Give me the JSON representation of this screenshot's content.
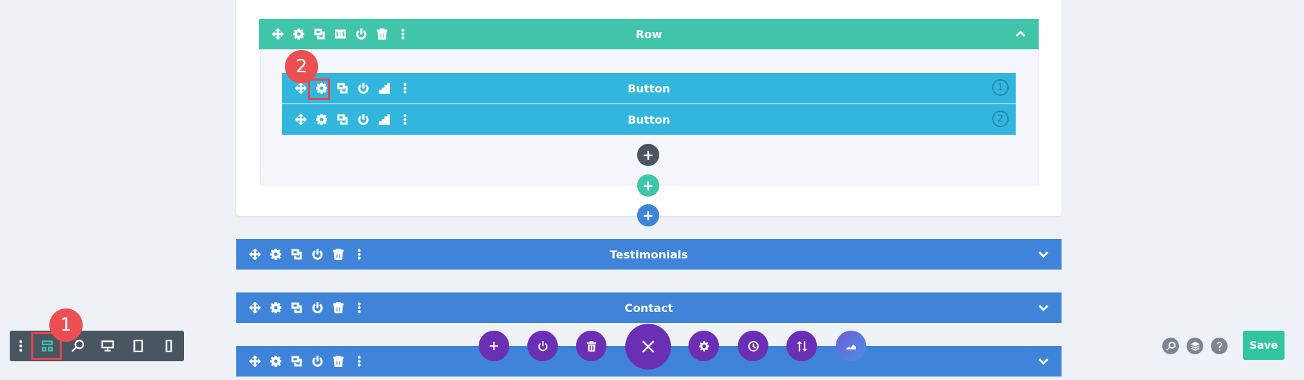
{
  "row": {
    "title": "Row"
  },
  "modules": [
    {
      "title": "Button",
      "number": "1"
    },
    {
      "title": "Button",
      "number": "2"
    }
  ],
  "sections": [
    {
      "title": "Testimonials"
    },
    {
      "title": "Contact"
    },
    {
      "title": ""
    }
  ],
  "add_buttons": {
    "module": "+",
    "row": "+",
    "section": "+"
  },
  "badges": {
    "one": "1",
    "two": "2"
  },
  "save": {
    "label": "Save"
  },
  "icons": {
    "move": "move-icon",
    "settings": "gear-icon",
    "duplicate": "duplicate-icon",
    "columns": "columns-icon",
    "power": "power-icon",
    "delete": "trash-icon",
    "more": "more-icon",
    "stats": "bars-icon"
  },
  "colors": {
    "row_green": "#40c4aa",
    "module_blue": "#33b6dd",
    "section_blue": "#3f84d9",
    "fab_purple": "#6b2fb5",
    "badge_red": "#eb4f52",
    "save_green": "#33c4a0"
  }
}
